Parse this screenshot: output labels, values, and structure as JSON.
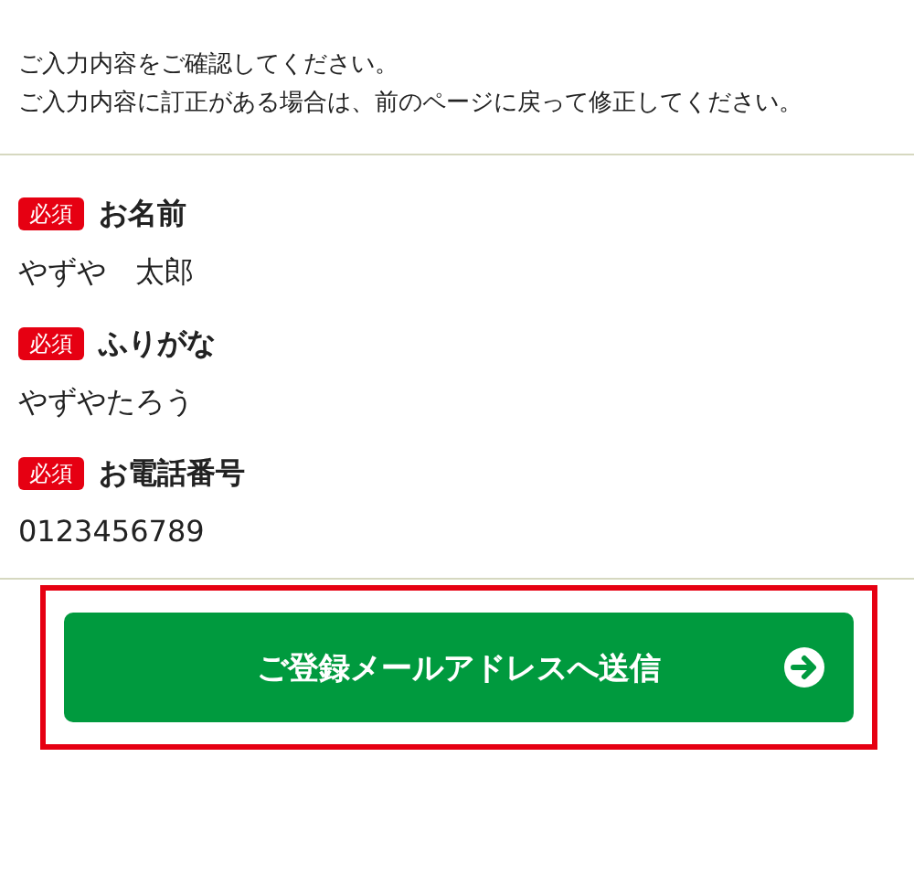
{
  "intro": [
    "ご入力内容をご確認してください。",
    "ご入力内容に訂正がある場合は、前のページに戻って修正してください。"
  ],
  "fields": [
    {
      "badge": "必須",
      "label": "お名前",
      "value": "やずや　太郎"
    },
    {
      "badge": "必須",
      "label": "ふりがな",
      "value": "やずやたろう"
    },
    {
      "badge": "必須",
      "label": "お電話番号",
      "value": "0123456789"
    }
  ],
  "submit_button": {
    "label": "ご登録メールアドレスへ送信"
  }
}
